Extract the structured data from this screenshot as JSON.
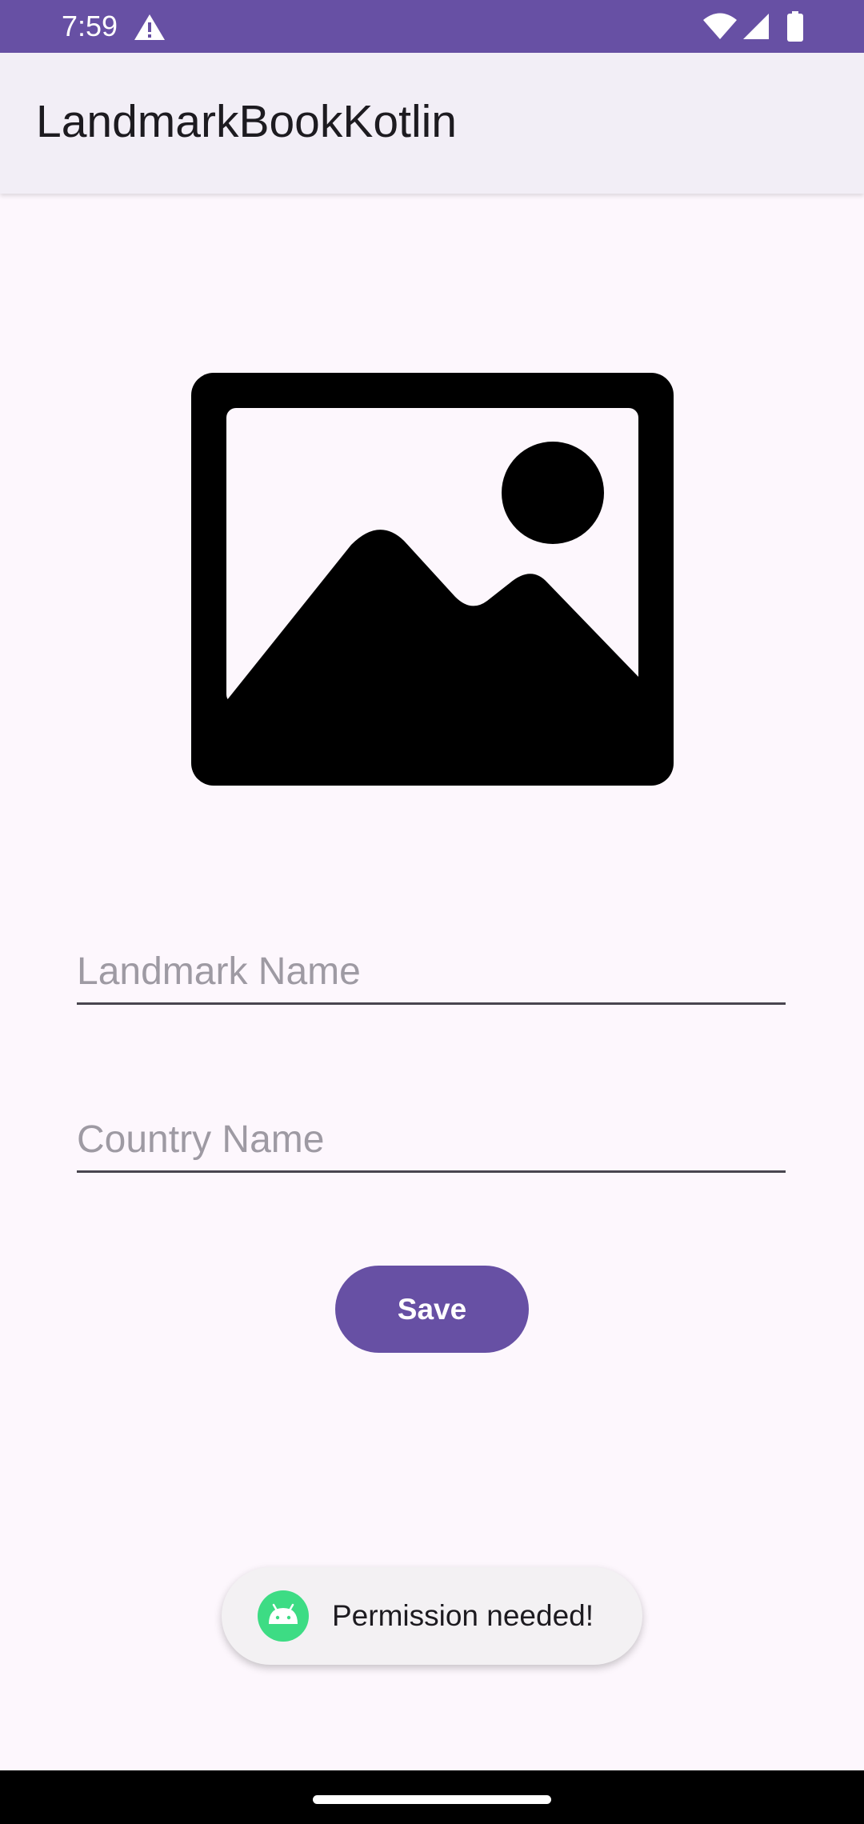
{
  "status_bar": {
    "time": "7:59",
    "icons": [
      "alert-icon",
      "wifi-icon",
      "signal-icon",
      "battery-icon"
    ],
    "color": "#6750A4"
  },
  "app_bar": {
    "title": "LandmarkBookKotlin"
  },
  "main": {
    "image_icon": "image-placeholder-icon",
    "landmark_field": {
      "placeholder": "Landmark Name",
      "value": ""
    },
    "country_field": {
      "placeholder": "Country Name",
      "value": ""
    },
    "save_label": "Save"
  },
  "toast": {
    "icon": "android-icon",
    "message": "Permission needed!"
  },
  "colors": {
    "accent": "#6750A4",
    "background": "#FDF7FD",
    "app_bar": "#F2EEF6"
  }
}
